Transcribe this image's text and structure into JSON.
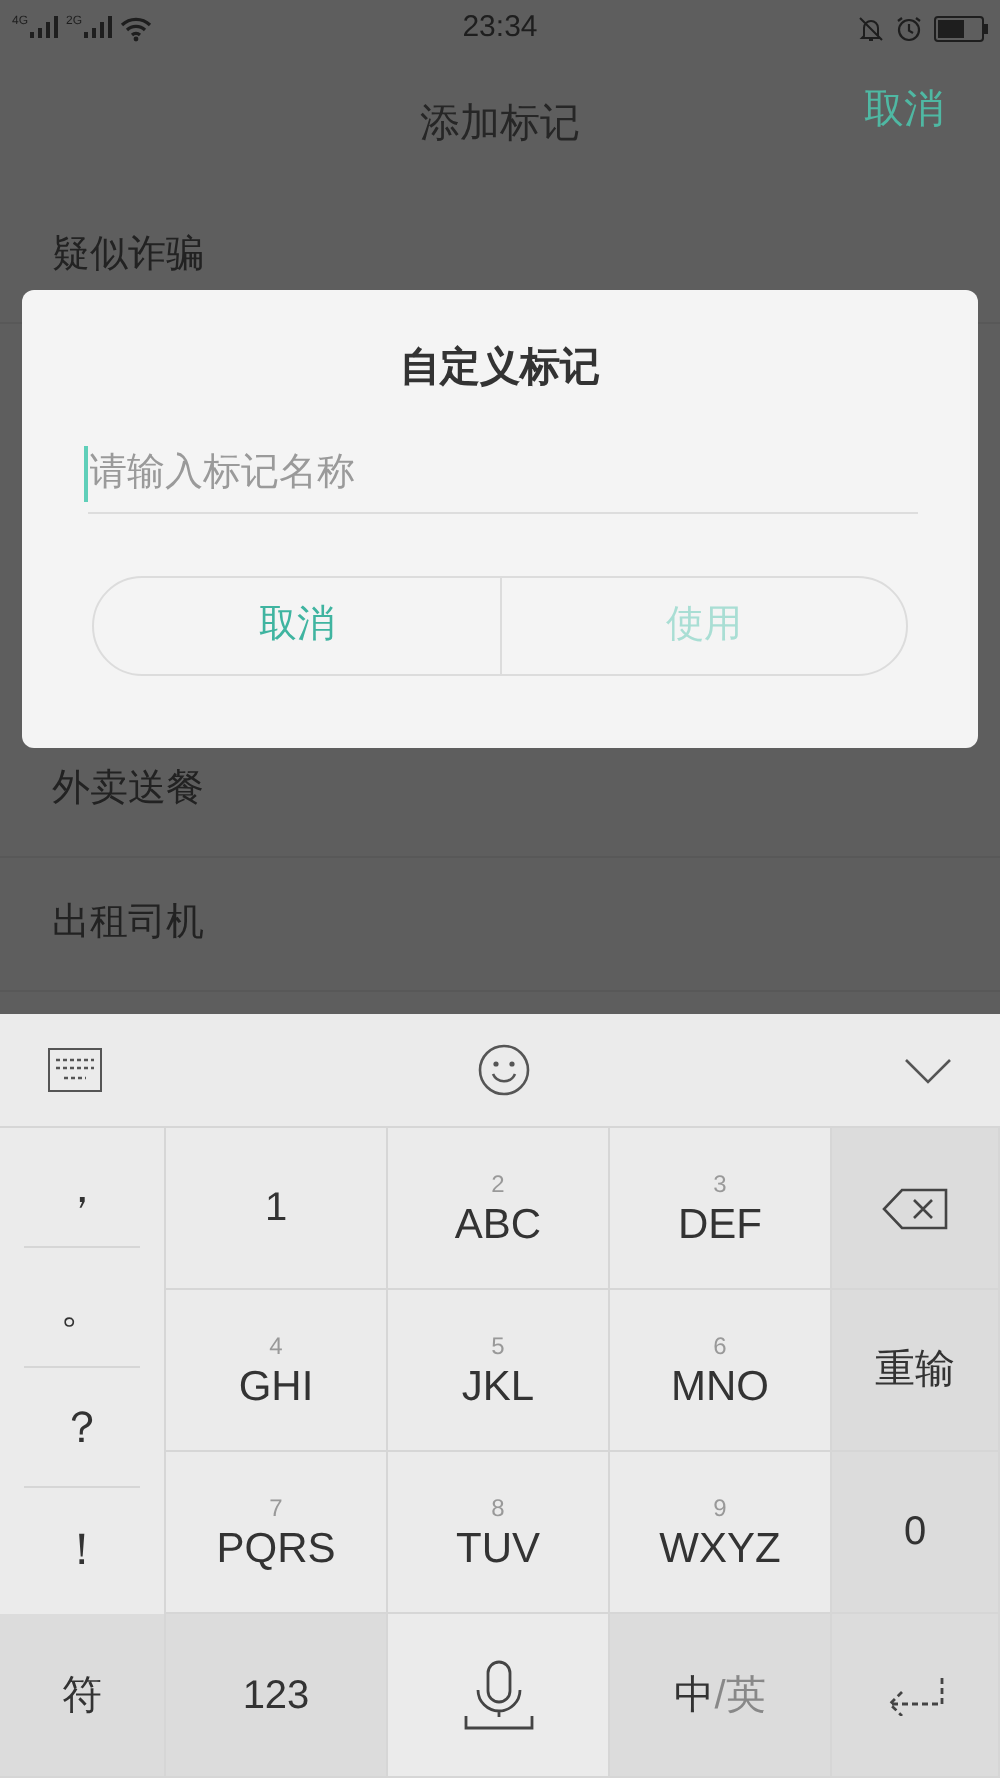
{
  "status_bar": {
    "networks": [
      "4G",
      "2G"
    ],
    "time": "23:34"
  },
  "header": {
    "title": "添加标记",
    "action": "取消"
  },
  "list": {
    "items": [
      "疑似诈骗",
      "外卖送餐",
      "出租司机"
    ]
  },
  "dialog": {
    "title": "自定义标记",
    "input": {
      "placeholder": "请输入标记名称"
    },
    "buttons": [
      {
        "label": "取消",
        "disabled": false
      },
      {
        "label": "使用",
        "disabled": true
      }
    ]
  },
  "keyboard": {
    "symbols": [
      "，",
      "。",
      "？",
      "！"
    ],
    "keys": [
      {
        "kind": "function",
        "label": "1"
      },
      {
        "kind": "digit",
        "digit": "2",
        "label": "ABC"
      },
      {
        "kind": "digit",
        "digit": "3",
        "label": "DEF"
      },
      {
        "kind": "backspace"
      },
      {
        "kind": "digit",
        "digit": "4",
        "label": "GHI"
      },
      {
        "kind": "digit",
        "digit": "5",
        "label": "JKL"
      },
      {
        "kind": "digit",
        "digit": "6",
        "label": "MNO"
      },
      {
        "kind": "function",
        "label": "重输"
      },
      {
        "kind": "digit",
        "digit": "7",
        "label": "PQRS"
      },
      {
        "kind": "digit",
        "digit": "8",
        "label": "TUV"
      },
      {
        "kind": "digit",
        "digit": "9",
        "label": "WXYZ"
      },
      {
        "kind": "function",
        "label": "0"
      },
      {
        "kind": "function",
        "label": "符"
      },
      {
        "kind": "function",
        "label": "123"
      },
      {
        "kind": "mic"
      },
      {
        "kind": "lang",
        "primary": "中",
        "secondary": "/英"
      },
      {
        "kind": "enter"
      }
    ]
  }
}
